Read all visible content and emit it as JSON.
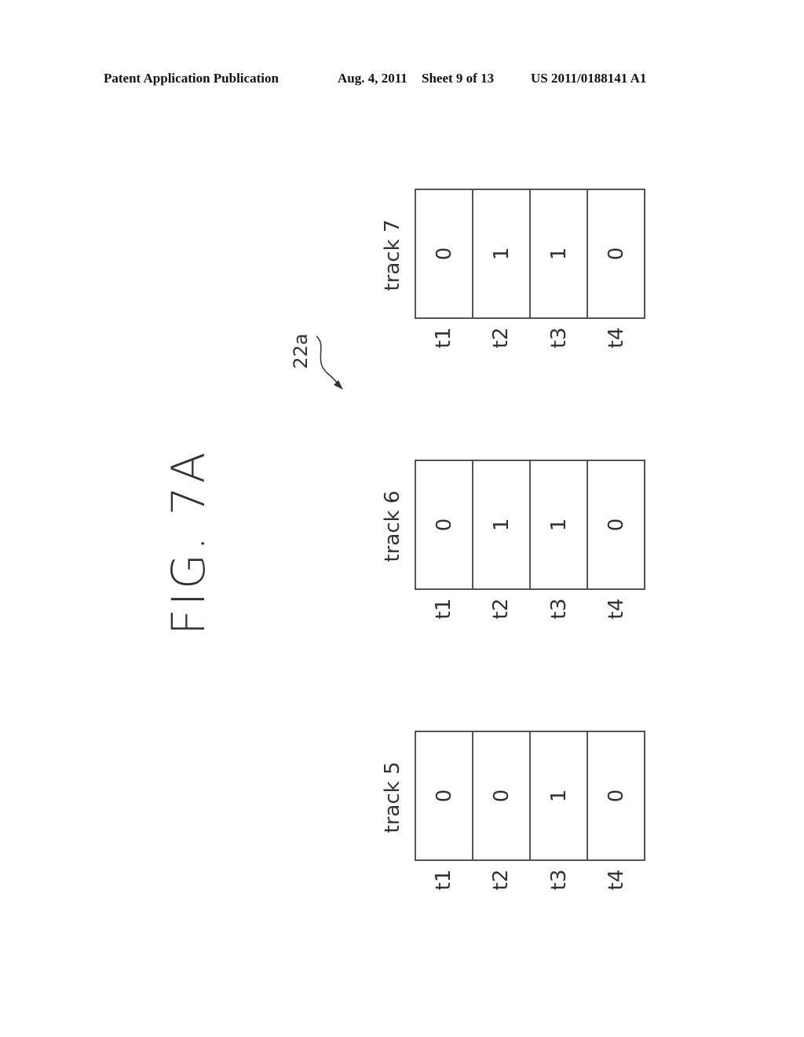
{
  "header": {
    "publication": "Patent Application Publication",
    "date": "Aug. 4, 2011",
    "sheet": "Sheet 9 of 13",
    "number": "US 2011/0188141 A1"
  },
  "figure": {
    "title": "FIG. 7A",
    "reference_label": "22a"
  },
  "tracks": [
    {
      "label": "track 7",
      "times": [
        "t1",
        "t2",
        "t3",
        "t4"
      ],
      "values": [
        "0",
        "1",
        "1",
        "0"
      ]
    },
    {
      "label": "track 6",
      "times": [
        "t1",
        "t2",
        "t3",
        "t4"
      ],
      "values": [
        "0",
        "1",
        "1",
        "0"
      ]
    },
    {
      "label": "track 5",
      "times": [
        "t1",
        "t2",
        "t3",
        "t4"
      ],
      "values": [
        "0",
        "0",
        "1",
        "0"
      ]
    }
  ]
}
